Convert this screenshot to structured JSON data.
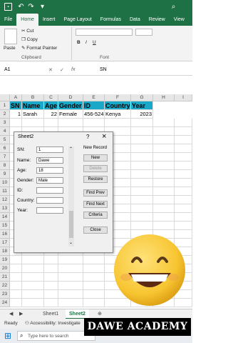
{
  "titlebar": {
    "save_icon": "save-icon",
    "undo": "↶",
    "redo": "↷",
    "search": "⌕"
  },
  "ribbon_tabs": [
    "File",
    "Home",
    "Insert",
    "Page Layout",
    "Formulas",
    "Data",
    "Review",
    "View"
  ],
  "active_tab": "Home",
  "clipboard": {
    "cut": "Cut",
    "copy": "Copy",
    "format_painter": "Format Painter",
    "paste": "Paste",
    "group": "Clipboard"
  },
  "font_group": "Font",
  "formula_bar": {
    "name_box": "A1",
    "fx": "fx",
    "value": "SN"
  },
  "columns": [
    "A",
    "B",
    "C",
    "D",
    "E",
    "F",
    "G",
    "H",
    "I"
  ],
  "rows": [
    "1",
    "2",
    "3",
    "4",
    "5",
    "6",
    "7",
    "8",
    "9",
    "10",
    "11",
    "12",
    "13",
    "14",
    "15",
    "16",
    "17",
    "18",
    "19",
    "20",
    "21",
    "22",
    "23",
    "24"
  ],
  "table": {
    "headers": [
      "SN",
      "Name",
      "Age",
      "Gender",
      "ID",
      "Country",
      "Year"
    ],
    "row1": [
      "1",
      "Sarah",
      "22",
      "Female",
      "456-524",
      "Kenya",
      "2023"
    ]
  },
  "dialog": {
    "title": "Sheet2",
    "help": "?",
    "close": "×",
    "record_status": "New Record",
    "fields": [
      {
        "label": "SN:",
        "value": "1"
      },
      {
        "label": "Name:",
        "value": "Dawe"
      },
      {
        "label": "Age:",
        "value": "18"
      },
      {
        "label": "Gender:",
        "value": "Male"
      },
      {
        "label": "ID:",
        "value": ""
      },
      {
        "label": "Country:",
        "value": ""
      },
      {
        "label": "Year:",
        "value": ""
      }
    ],
    "buttons": [
      "New",
      "Delete",
      "Restore",
      "Find Prev",
      "Find Next",
      "Criteria",
      "Close"
    ]
  },
  "sheet_tabs": [
    "Sheet1",
    "Sheet2"
  ],
  "active_sheet": "Sheet2",
  "status": {
    "ready": "Ready",
    "accessibility": "Accessibility: Investigate"
  },
  "taskbar": {
    "search": "Type here to search"
  },
  "branding": "DAWE ACADEMY",
  "colors": {
    "excel_green": "#1e7145",
    "header_fill": "#1aa8c8",
    "emoji_yellow": "#f7c531"
  }
}
